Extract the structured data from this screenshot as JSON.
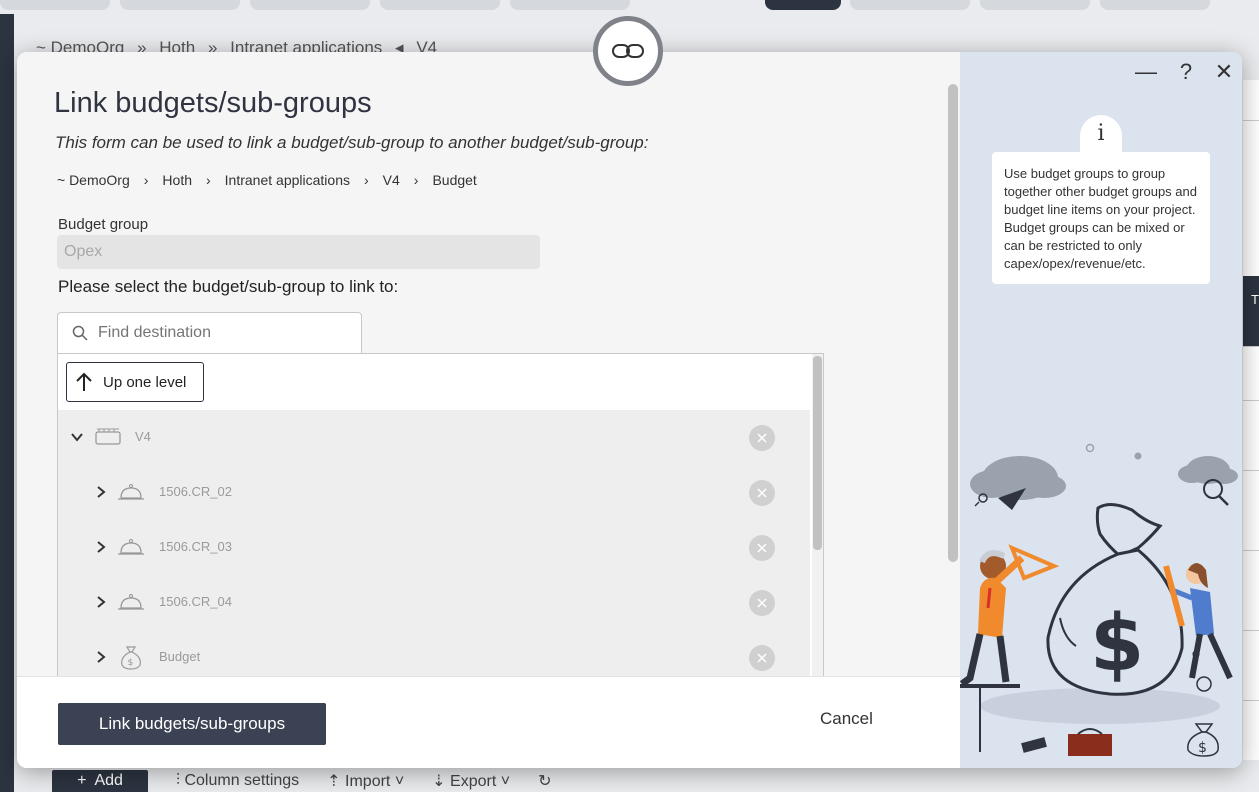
{
  "background": {
    "breadcrumb": [
      "~ DemoOrg",
      "»",
      "Hoth",
      "»",
      "Intranet applications",
      "◂",
      "V4"
    ],
    "right_header": "T",
    "toolbar": {
      "add_label": "Add",
      "column_settings_label": "Column settings",
      "import_label": "Import",
      "export_label": "Export"
    }
  },
  "modal": {
    "title": "Link budgets/sub-groups",
    "subtitle": "This form can be used to link a budget/sub-group to another budget/sub-group:",
    "breadcrumb": [
      "~ DemoOrg",
      "Hoth",
      "Intranet applications",
      "V4",
      "Budget"
    ],
    "budget_group": {
      "label": "Budget group",
      "value": "Opex"
    },
    "prompt": "Please select the budget/sub-group to link to:",
    "search": {
      "placeholder": "Find destination",
      "icon": "search-icon"
    },
    "up_level_label": "Up one level",
    "tree": [
      {
        "label": "V4",
        "icon": "board-icon",
        "expanded": true,
        "indent": 0
      },
      {
        "label": "1506.CR_02",
        "icon": "bell-icon",
        "expanded": false,
        "indent": 1
      },
      {
        "label": "1506.CR_03",
        "icon": "bell-icon",
        "expanded": false,
        "indent": 1
      },
      {
        "label": "1506.CR_04",
        "icon": "bell-icon",
        "expanded": false,
        "indent": 1
      },
      {
        "label": "Budget",
        "icon": "money-bag-icon",
        "expanded": false,
        "indent": 1
      }
    ],
    "footer": {
      "primary_label": "Link budgets/sub-groups",
      "cancel_label": "Cancel"
    },
    "help": {
      "minimize": "—",
      "help": "?",
      "close": "✕",
      "info_icon": "i",
      "text": "Use budget groups to group together other budget groups and budget line items on your project. Budget groups can be mixed or can be restricted to only capex/opex/revenue/etc."
    }
  },
  "colors": {
    "primary_button": "#3b4253",
    "side_panel": "#dbe3ef",
    "illustration_orange": "#f08a2c",
    "illustration_navy": "#2f3440"
  }
}
